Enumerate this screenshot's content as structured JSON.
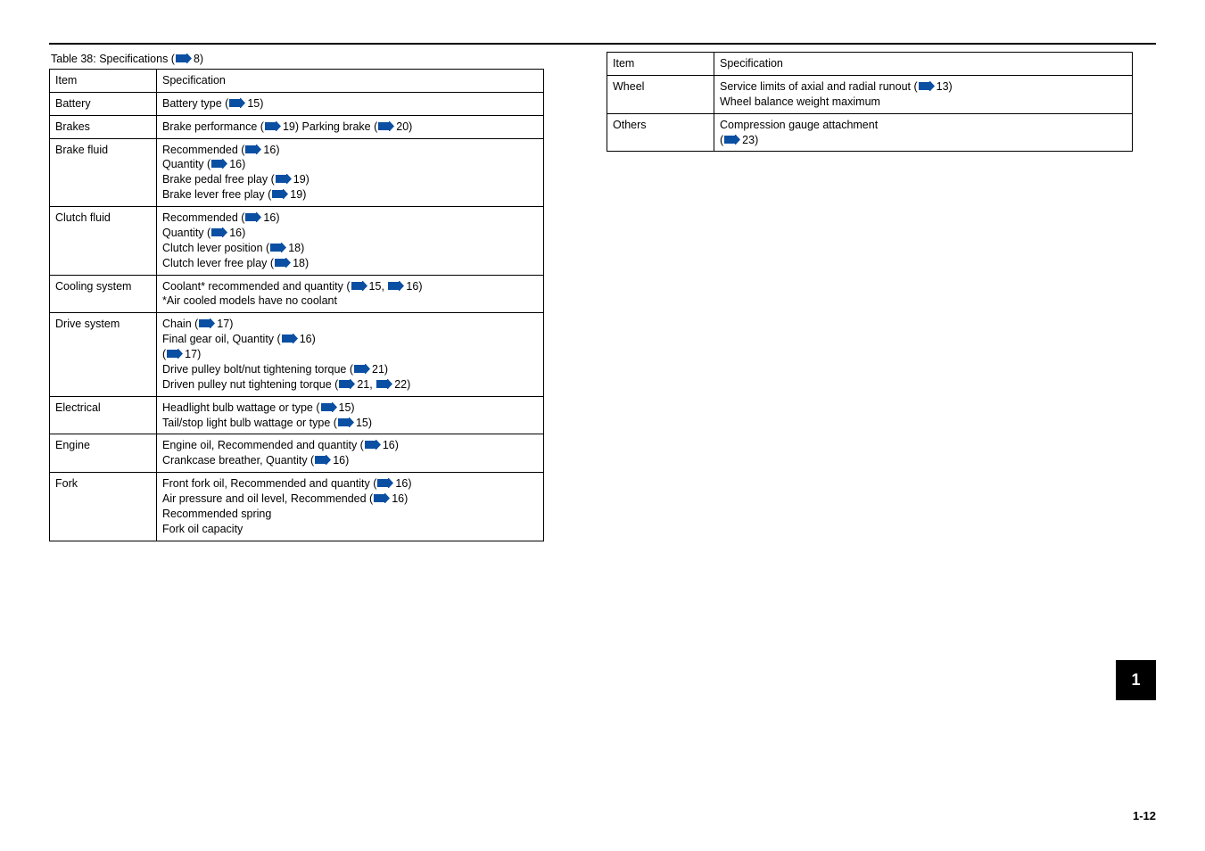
{
  "caption": "Table 38: Specifications (",
  "caption_link": "8",
  "caption_tail": ")",
  "headers": {
    "item": "Item",
    "spec": "Specification"
  },
  "rows": [
    {
      "item": "Battery",
      "content": [
        {
          "t": "text",
          "v": "Battery type ("
        },
        {
          "t": "link",
          "v": "15"
        },
        {
          "t": "text",
          "v": ")"
        }
      ]
    },
    {
      "item": "Brakes",
      "content": [
        {
          "t": "text",
          "v": "Brake performance ("
        },
        {
          "t": "link",
          "v": "19"
        },
        {
          "t": "text",
          "v": ") Parking brake ("
        },
        {
          "t": "link",
          "v": "20"
        },
        {
          "t": "text",
          "v": ")"
        }
      ]
    },
    {
      "item": "Brake fluid",
      "content": [
        {
          "t": "text",
          "v": "Recommended ("
        },
        {
          "t": "link",
          "v": "16"
        },
        {
          "t": "text",
          "v": ")"
        },
        {
          "t": "br"
        },
        {
          "t": "text",
          "v": "Quantity ("
        },
        {
          "t": "link",
          "v": "16"
        },
        {
          "t": "text",
          "v": ")"
        },
        {
          "t": "br"
        },
        {
          "t": "text",
          "v": "Brake pedal free play ("
        },
        {
          "t": "link",
          "v": "19"
        },
        {
          "t": "text",
          "v": ")"
        },
        {
          "t": "br"
        },
        {
          "t": "text",
          "v": "Brake lever free play ("
        },
        {
          "t": "link",
          "v": "19"
        },
        {
          "t": "text",
          "v": ")"
        }
      ]
    },
    {
      "item": "Clutch fluid",
      "content": [
        {
          "t": "text",
          "v": "Recommended ("
        },
        {
          "t": "link",
          "v": "16"
        },
        {
          "t": "text",
          "v": ")"
        },
        {
          "t": "br"
        },
        {
          "t": "text",
          "v": "Quantity ("
        },
        {
          "t": "link",
          "v": "16"
        },
        {
          "t": "text",
          "v": ")"
        },
        {
          "t": "br"
        },
        {
          "t": "text",
          "v": "Clutch lever position ("
        },
        {
          "t": "link",
          "v": "18"
        },
        {
          "t": "text",
          "v": ")"
        },
        {
          "t": "br"
        },
        {
          "t": "text",
          "v": "Clutch lever free play ("
        },
        {
          "t": "link",
          "v": "18"
        },
        {
          "t": "text",
          "v": ")"
        }
      ]
    },
    {
      "item": "Cooling system",
      "content": [
        {
          "t": "text",
          "v": "Coolant* recommended and quantity ("
        },
        {
          "t": "link",
          "v": "15"
        },
        {
          "t": "text",
          "v": ", "
        },
        {
          "t": "link",
          "v": "16"
        },
        {
          "t": "text",
          "v": ")"
        },
        {
          "t": "br"
        },
        {
          "t": "text",
          "v": "*Air cooled models have no coolant"
        }
      ]
    },
    {
      "item": "Drive system",
      "content": [
        {
          "t": "text",
          "v": "Chain ("
        },
        {
          "t": "link",
          "v": "17"
        },
        {
          "t": "text",
          "v": ")"
        },
        {
          "t": "br"
        },
        {
          "t": "text",
          "v": "Final gear oil, Quantity ("
        },
        {
          "t": "link",
          "v": "16"
        },
        {
          "t": "text",
          "v": ")"
        },
        {
          "t": "br"
        },
        {
          "t": "text",
          "v": "("
        },
        {
          "t": "link",
          "v": "17"
        },
        {
          "t": "text",
          "v": ")"
        },
        {
          "t": "br"
        },
        {
          "t": "text",
          "v": "Drive pulley bolt/nut tightening torque ("
        },
        {
          "t": "link",
          "v": "21"
        },
        {
          "t": "text",
          "v": ")"
        },
        {
          "t": "br"
        },
        {
          "t": "text",
          "v": "Driven pulley nut tightening torque ("
        },
        {
          "t": "link",
          "v": "21"
        },
        {
          "t": "text",
          "v": ", "
        },
        {
          "t": "link",
          "v": "22"
        },
        {
          "t": "text",
          "v": ")"
        }
      ]
    },
    {
      "item": "Electrical",
      "content": [
        {
          "t": "text",
          "v": "Headlight bulb wattage or type ("
        },
        {
          "t": "link",
          "v": "15"
        },
        {
          "t": "text",
          "v": ")"
        },
        {
          "t": "br"
        },
        {
          "t": "text",
          "v": "Tail/stop light bulb wattage or type ("
        },
        {
          "t": "link",
          "v": "15"
        },
        {
          "t": "text",
          "v": ")"
        }
      ]
    },
    {
      "item": "Engine",
      "content": [
        {
          "t": "text",
          "v": "Engine oil, Recommended and quantity ("
        },
        {
          "t": "link",
          "v": "16"
        },
        {
          "t": "text",
          "v": ")"
        },
        {
          "t": "br"
        },
        {
          "t": "text",
          "v": "Crankcase breather, Quantity ("
        },
        {
          "t": "link",
          "v": "16"
        },
        {
          "t": "text",
          "v": ")"
        }
      ]
    },
    {
      "item": "Fork",
      "content": [
        {
          "t": "text",
          "v": "Front fork oil, Recommended and quantity ("
        },
        {
          "t": "link",
          "v": "16"
        },
        {
          "t": "text",
          "v": ")"
        },
        {
          "t": "br"
        },
        {
          "t": "text",
          "v": "Air pressure and oil level, Recommended ("
        },
        {
          "t": "link",
          "v": "16"
        },
        {
          "t": "text",
          "v": ")"
        },
        {
          "t": "br"
        },
        {
          "t": "text",
          "v": "Recommended spring"
        },
        {
          "t": "br"
        },
        {
          "t": "text",
          "v": "Fork oil capacity"
        }
      ]
    }
  ],
  "right_table": {
    "headers": {
      "item": "Item",
      "spec": "Specification"
    },
    "rows": [
      {
        "item": "Wheel",
        "content": [
          {
            "t": "text",
            "v": "Service limits of axial and radial runout ("
          },
          {
            "t": "link",
            "v": "13"
          },
          {
            "t": "text",
            "v": ")"
          },
          {
            "t": "br"
          },
          {
            "t": "text",
            "v": "Wheel balance weight maximum"
          }
        ]
      },
      {
        "item": "Others",
        "content": [
          {
            "t": "text",
            "v": "Compression gauge attachment"
          },
          {
            "t": "br"
          },
          {
            "t": "text",
            "v": "("
          },
          {
            "t": "link",
            "v": "23"
          },
          {
            "t": "text",
            "v": ")"
          }
        ]
      }
    ]
  },
  "side_tab": "1",
  "page_number": "1-12"
}
